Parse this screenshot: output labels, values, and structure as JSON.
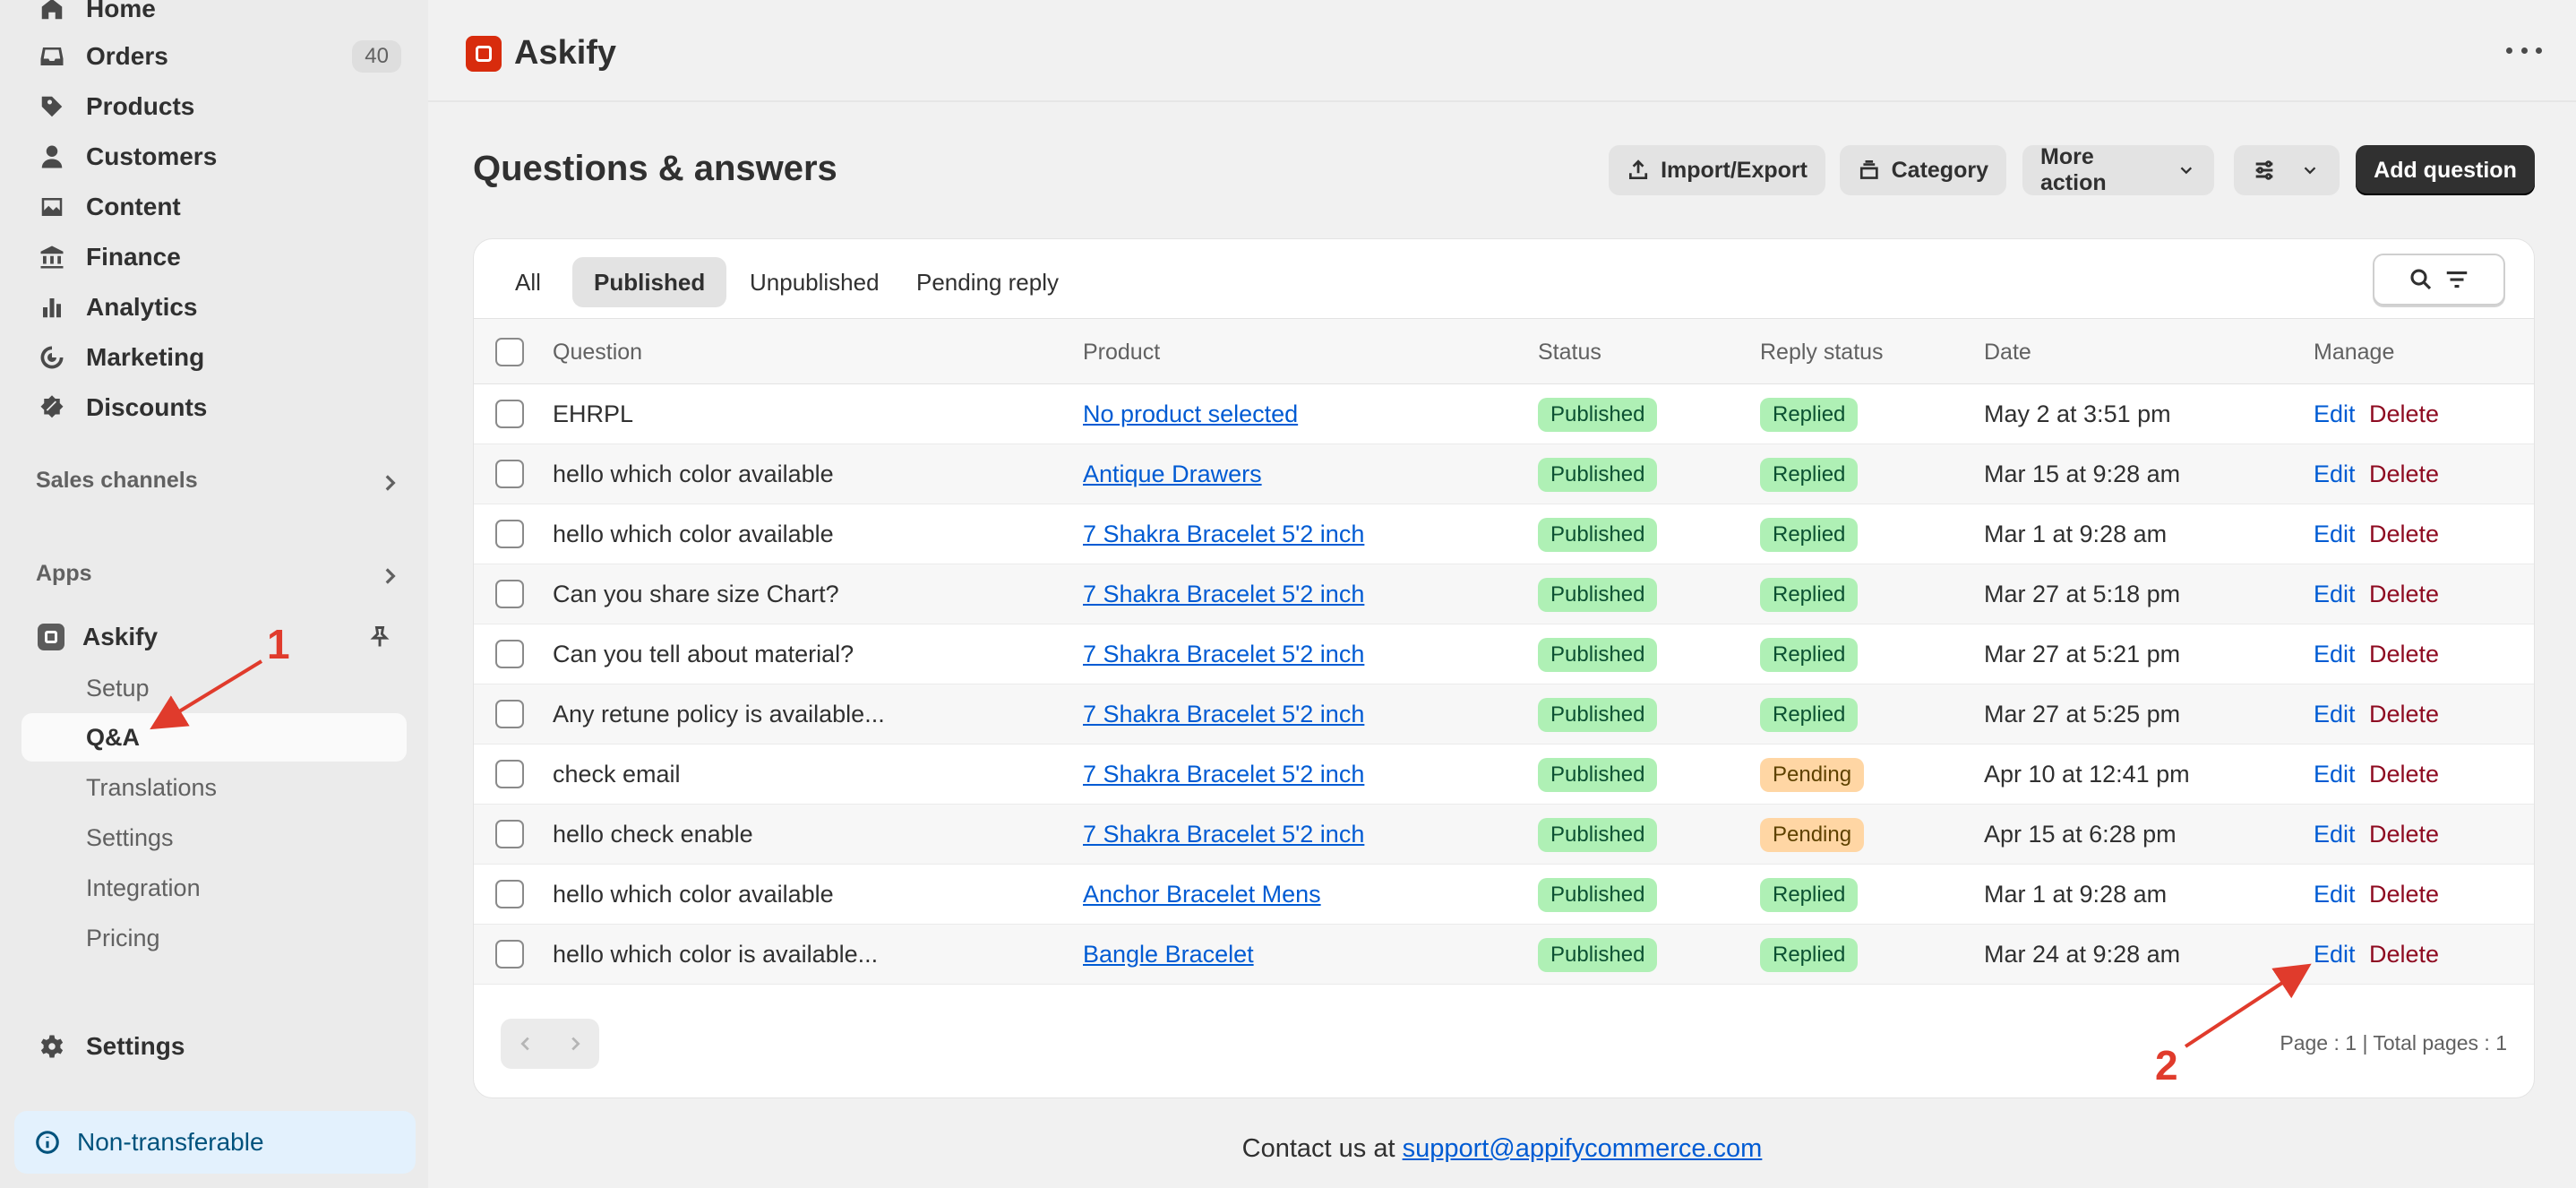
{
  "sidebar": {
    "nav": [
      {
        "label": "Home",
        "icon": "home-icon"
      },
      {
        "label": "Orders",
        "icon": "inbox-icon",
        "count": "40"
      },
      {
        "label": "Products",
        "icon": "tag-icon"
      },
      {
        "label": "Customers",
        "icon": "person-icon"
      },
      {
        "label": "Content",
        "icon": "image-icon"
      },
      {
        "label": "Finance",
        "icon": "bank-icon"
      },
      {
        "label": "Analytics",
        "icon": "bar-chart-icon"
      },
      {
        "label": "Marketing",
        "icon": "target-icon"
      },
      {
        "label": "Discounts",
        "icon": "discount-icon"
      }
    ],
    "sales_channels": "Sales channels",
    "apps": "Apps",
    "app_name": "Askify",
    "app_sub": [
      "Setup",
      "Q&A",
      "Translations",
      "Settings",
      "Integration",
      "Pricing"
    ],
    "settings": "Settings",
    "notice": "Non-transferable"
  },
  "header": {
    "brand": "Askify"
  },
  "page": {
    "title": "Questions & answers",
    "buttons": {
      "import_export": "Import/Export",
      "category": "Category",
      "more_action": "More action",
      "add_question": "Add question"
    },
    "tabs": [
      "All",
      "Published",
      "Unpublished",
      "Pending reply"
    ],
    "selected_tab": "Published"
  },
  "table": {
    "columns": [
      "Question",
      "Product",
      "Status",
      "Reply status",
      "Date",
      "Manage"
    ],
    "rows": [
      {
        "question": "EHRPL",
        "product": "No product selected",
        "status": "Published",
        "reply": "Replied",
        "date": "May 2 at 3:51 pm"
      },
      {
        "question": "hello which color available",
        "product": "Antique Drawers",
        "status": "Published",
        "reply": "Replied",
        "date": "Mar 15 at 9:28 am"
      },
      {
        "question": "hello which color available",
        "product": "7 Shakra Bracelet 5'2 inch",
        "status": "Published",
        "reply": "Replied",
        "date": "Mar 1 at 9:28 am"
      },
      {
        "question": "Can you share size Chart?",
        "product": "7 Shakra Bracelet 5'2 inch",
        "status": "Published",
        "reply": "Replied",
        "date": "Mar 27 at 5:18 pm"
      },
      {
        "question": "Can you tell about material?",
        "product": "7 Shakra Bracelet 5'2 inch",
        "status": "Published",
        "reply": "Replied",
        "date": "Mar 27 at 5:21 pm"
      },
      {
        "question": "Any retune policy is available...",
        "product": "7 Shakra Bracelet 5'2 inch",
        "status": "Published",
        "reply": "Replied",
        "date": "Mar 27 at 5:25 pm"
      },
      {
        "question": "check email",
        "product": "7 Shakra Bracelet 5'2 inch",
        "status": "Published",
        "reply": "Pending",
        "date": "Apr 10 at 12:41 pm"
      },
      {
        "question": "hello check enable",
        "product": "7 Shakra Bracelet 5'2 inch",
        "status": "Published",
        "reply": "Pending",
        "date": "Apr 15 at 6:28 pm"
      },
      {
        "question": "hello which color available",
        "product": "Anchor Bracelet Mens",
        "status": "Published",
        "reply": "Replied",
        "date": "Mar 1 at 9:28 am"
      },
      {
        "question": "hello which color is available...",
        "product": "Bangle Bracelet",
        "status": "Published",
        "reply": "Replied",
        "date": "Mar 24 at 9:28 am"
      }
    ],
    "edit_label": "Edit",
    "delete_label": "Delete",
    "page_info": "Page : 1 | Total pages : 1"
  },
  "footer": {
    "contact_prefix": "Contact us at",
    "contact_email": "support@appifycommerce.com"
  },
  "annotations": [
    "1",
    "2"
  ],
  "colors": {
    "accent": "#d82c0d",
    "link": "#005bd3",
    "delete": "#8e0b21",
    "annotation": "#e03b2c"
  }
}
